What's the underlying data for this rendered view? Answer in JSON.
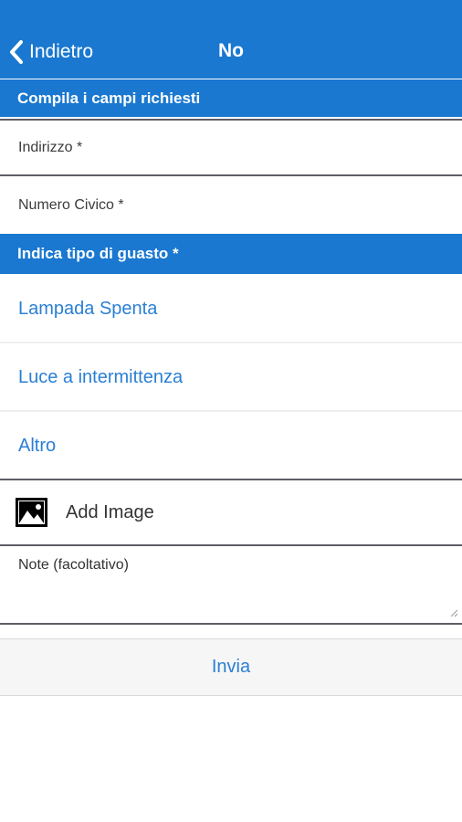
{
  "navbar": {
    "back_label": "Indietro",
    "title": "No"
  },
  "form": {
    "required_header": "Compila i campi richiesti",
    "address_placeholder": "Indirizzo *",
    "street_number_placeholder": "Numero Civico *",
    "fault_header": "Indica tipo di guasto *",
    "fault_options": [
      {
        "label": "Lampada Spenta"
      },
      {
        "label": "Luce a intermittenza"
      },
      {
        "label": "Altro"
      }
    ],
    "add_image_label": "Add Image",
    "add_image_icon": "image-icon",
    "notes_placeholder": "Note (facoltativo)",
    "submit_label": "Invia"
  },
  "colors": {
    "primary": "#1a78d0",
    "link": "#2a7fd4"
  }
}
